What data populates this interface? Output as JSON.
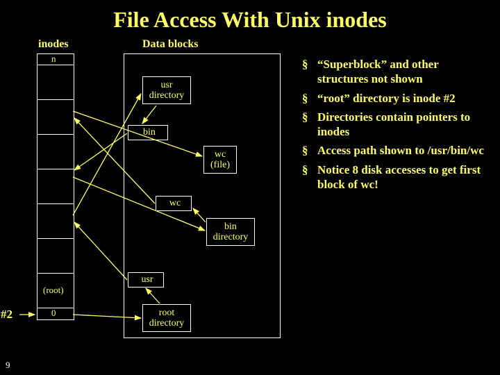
{
  "title": "File Access With Unix inodes",
  "labels": {
    "inodes": "inodes",
    "datablocks": "Data blocks"
  },
  "inode_table": {
    "top_n": "n",
    "root": "(root)",
    "bottom_0": "0"
  },
  "boxes": {
    "usr_dir": "usr\ndirectory",
    "bin_label": "bin",
    "wc_file": "wc\n(file)",
    "wc_label": "wc",
    "bin_dir": "bin\ndirectory",
    "usr_label": "usr",
    "root_dir": "root\ndirectory"
  },
  "markers": {
    "num2": "#2",
    "slide_number": "9"
  },
  "bullets": [
    "“Superblock” and other structures not shown",
    "“root” directory is inode #2",
    "Directories contain pointers to inodes",
    "Access path shown to /usr/bin/wc",
    "Notice 8 disk accesses to get first block of wc!"
  ]
}
